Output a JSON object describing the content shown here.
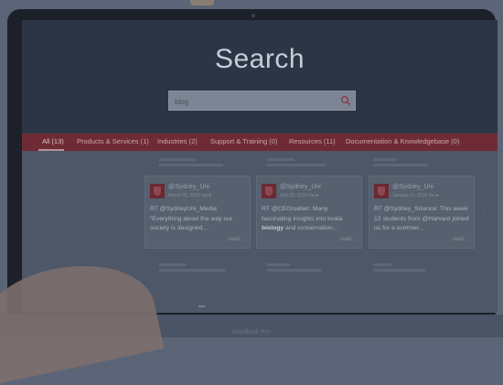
{
  "page": {
    "title": "Search"
  },
  "search": {
    "value": "blog",
    "placeholder": ""
  },
  "tabs": [
    {
      "label": "All (13)",
      "active": true
    },
    {
      "label": "Products & Services (1)",
      "active": false
    },
    {
      "label": "Industries (2)",
      "active": false
    },
    {
      "label": "Support & Training (0)",
      "active": false
    },
    {
      "label": "Resources (11)",
      "active": false
    },
    {
      "label": "Documentation & Knowledgebase (0)",
      "active": false
    }
  ],
  "cards": [
    {
      "handle": "@Sydney_Uni",
      "date": "March 30, 2016 via ●",
      "text": "RT @SydneyUni_Media: “Everything about the way our society is designed,...",
      "read_more": "read..."
    },
    {
      "handle": "@Sydney_Uni",
      "date": "July 23, 2016 via ●",
      "text_pre": "RT @CEGrueber: Many fascinating insights into koala ",
      "text_bold": "biology",
      "text_post": " and conservation...",
      "read_more": "read..."
    },
    {
      "handle": "@Sydney_Uni",
      "date": "January 11, 2016 via ●",
      "text": "RT @Sydney_Science: This week 12 students from @Harvard joined us for a summer...",
      "read_more": "read..."
    }
  ],
  "device": {
    "brand": "MacBook Pro"
  },
  "colors": {
    "tabbar": "#6f2b35",
    "accent": "#c0616c",
    "hero": "#2b3546"
  }
}
